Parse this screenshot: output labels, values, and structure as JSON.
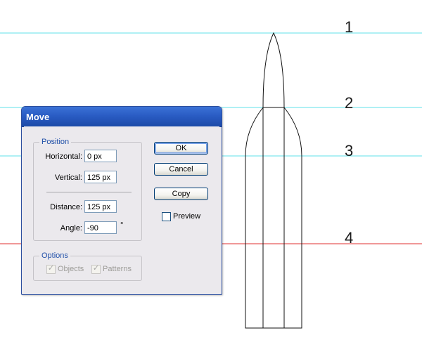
{
  "guides": {
    "numbers": [
      "1",
      "2",
      "3",
      "4"
    ],
    "cyan_color": "#5fe0ea",
    "red_color": "#e03030"
  },
  "dialog": {
    "title": "Move",
    "position": {
      "legend": "Position",
      "horizontal_label": "Horizontal:",
      "horizontal_value": "0 px",
      "vertical_label": "Vertical:",
      "vertical_value": "125 px",
      "distance_label": "Distance:",
      "distance_value": "125 px",
      "angle_label": "Angle:",
      "angle_value": "-90",
      "angle_unit": "°"
    },
    "options": {
      "legend": "Options",
      "objects_label": "Objects",
      "objects_checked": true,
      "patterns_label": "Patterns",
      "patterns_checked": true
    },
    "buttons": {
      "ok": "OK",
      "cancel": "Cancel",
      "copy": "Copy"
    },
    "preview_label": "Preview",
    "preview_checked": false,
    "title_bar_color": "#2a5cc4"
  }
}
